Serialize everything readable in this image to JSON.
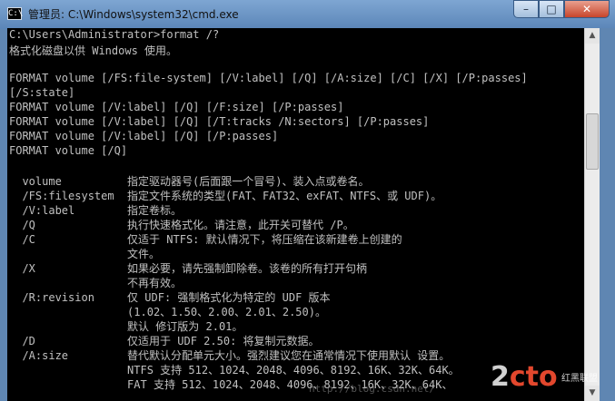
{
  "window": {
    "title": "管理员: C:\\Windows\\system32\\cmd.exe",
    "icon_text": "C:\\",
    "controls": {
      "minimize": "–",
      "maximize": "□",
      "close": "✕"
    },
    "icons": [
      "cmd-icon",
      "minimize-icon",
      "maximize-icon",
      "close-icon",
      "scroll-up-arrow-icon",
      "scroll-down-arrow-icon"
    ]
  },
  "console": {
    "lines": [
      "C:\\Users\\Administrator>format /?",
      "格式化磁盘以供 Windows 使用。",
      "",
      "FORMAT volume [/FS:file-system] [/V:label] [/Q] [/A:size] [/C] [/X] [/P:passes]",
      "[/S:state]",
      "FORMAT volume [/V:label] [/Q] [/F:size] [/P:passes]",
      "FORMAT volume [/V:label] [/Q] [/T:tracks /N:sectors] [/P:passes]",
      "FORMAT volume [/V:label] [/Q] [/P:passes]",
      "FORMAT volume [/Q]",
      "",
      "  volume          指定驱动器号(后面跟一个冒号)、装入点或卷名。",
      "  /FS:filesystem  指定文件系统的类型(FAT、FAT32、exFAT、NTFS、或 UDF)。",
      "  /V:label        指定卷标。",
      "  /Q              执行快速格式化。请注意，此开关可替代 /P。",
      "  /C              仅适于 NTFS: 默认情况下，将压缩在该新建卷上创建的",
      "                  文件。",
      "  /X              如果必要，请先强制卸除卷。该卷的所有打开句柄",
      "                  不再有效。",
      "  /R:revision     仅 UDF: 强制格式化为特定的 UDF 版本",
      "                  (1.02、1.50、2.00、2.01、2.50)。",
      "                  默认 修订版为 2.01。",
      "  /D              仅适用于 UDF 2.50: 将复制元数据。",
      "  /A:size         替代默认分配单元大小。强烈建议您在通常情况下使用默认 设置。",
      "                  NTFS 支持 512、1024、2048、4096、8192、16K、32K、64K。",
      "                  FAT 支持 512、1024、2048、4096、8192、16K、32K、64K、"
    ]
  },
  "watermark": {
    "logo_a": "2",
    "logo_b": "cto",
    "sub": "红黑联盟",
    "url": "http://blog.csdn.net/"
  }
}
